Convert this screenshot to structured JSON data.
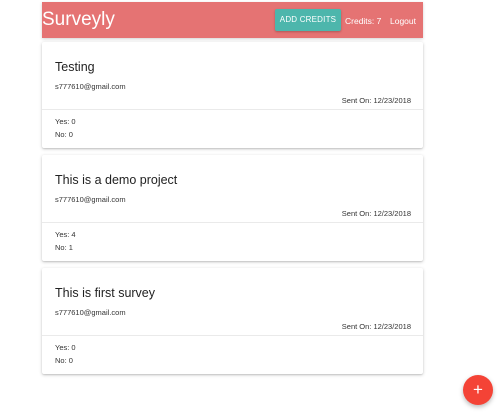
{
  "header": {
    "brand": "Surveyly",
    "add_credits_label": "ADD CREDITS",
    "credits_text": "Credits: 7",
    "logout_label": "Logout"
  },
  "surveys": [
    {
      "title": "Testing",
      "email": "s777610@gmail.com",
      "sent_on": "Sent On: 12/23/2018",
      "yes": "Yes: 0",
      "no": "No: 0"
    },
    {
      "title": "This is a demo project",
      "email": "s777610@gmail.com",
      "sent_on": "Sent On: 12/23/2018",
      "yes": "Yes: 4",
      "no": "No: 1"
    },
    {
      "title": "This is first survey",
      "email": "s777610@gmail.com",
      "sent_on": "Sent On: 12/23/2018",
      "yes": "Yes: 0",
      "no": "No: 0"
    }
  ],
  "fab": {
    "icon": "plus-icon",
    "glyph": "+"
  },
  "colors": {
    "navbar": "#e57373",
    "add_credits": "#4db6ac",
    "fab": "#f44336"
  }
}
